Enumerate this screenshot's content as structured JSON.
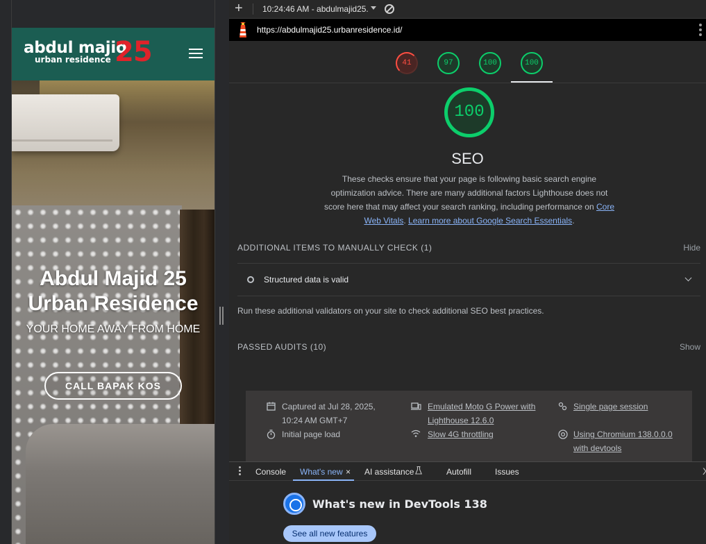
{
  "site": {
    "logo_main": "abdul majid",
    "logo_number": "25",
    "logo_sub": "urban residence",
    "hero_title_line1": "Abdul Majid 25",
    "hero_title_line2": "Urban Residence",
    "hero_tagline": "YOUR HOME AWAY FROM HOME",
    "cta_label": "CALL BAPAK KOS"
  },
  "toolbar": {
    "plus_glyph": "+",
    "run_label": "10:24:46 AM - abdulmajid25."
  },
  "urlbar": {
    "url": "https://abdulmajid25.urbanresidence.id/"
  },
  "scores": [
    {
      "value": "41",
      "status": "bad"
    },
    {
      "value": "97",
      "status": "good"
    },
    {
      "value": "100",
      "status": "good"
    },
    {
      "value": "100",
      "status": "good"
    }
  ],
  "seo": {
    "score": "100",
    "title": "SEO",
    "description": "These checks ensure that your page is following basic search engine optimization advice. There are many additional factors Lighthouse does not score here that may affect your search ranking, including performance on",
    "link1": "Core Web Vitals",
    "sep": ". ",
    "link2": "Learn more about Google Search Essentials",
    "end": "."
  },
  "manual": {
    "heading": "ADDITIONAL ITEMS TO MANUALLY CHECK",
    "count": "(1)",
    "action": "Hide",
    "item": "Structured data is valid",
    "note": "Run these additional validators on your site to check additional SEO best practices."
  },
  "passed": {
    "heading": "PASSED AUDITS",
    "count": "(10)",
    "action": "Show"
  },
  "meta": {
    "captured_line1": "Captured at Jul 28, 2025,",
    "captured_line2": "10:24 AM GMT+7",
    "initial_load": "Initial page load",
    "emulated_line1": "Emulated Moto G Power with",
    "emulated_line2": "Lighthouse 12.6.0",
    "throttling": "Slow 4G throttling",
    "session": "Single page session",
    "chromium_line1": "Using Chromium 138.0.0.0",
    "chromium_line2": "with devtools"
  },
  "drawer": {
    "tabs": [
      "Console",
      "What's new",
      "AI assistance",
      "Autofill",
      "Issues"
    ],
    "close_glyph": "×",
    "panel_close_glyph": "X",
    "title": "What's new in DevTools 138",
    "button": "See all new features"
  },
  "colors": {
    "site_header": "#1b5d52",
    "logo_number": "#e0232a",
    "score_good": "#0cce6b",
    "score_bad": "#ff4e42",
    "link": "#8ab4f8"
  }
}
